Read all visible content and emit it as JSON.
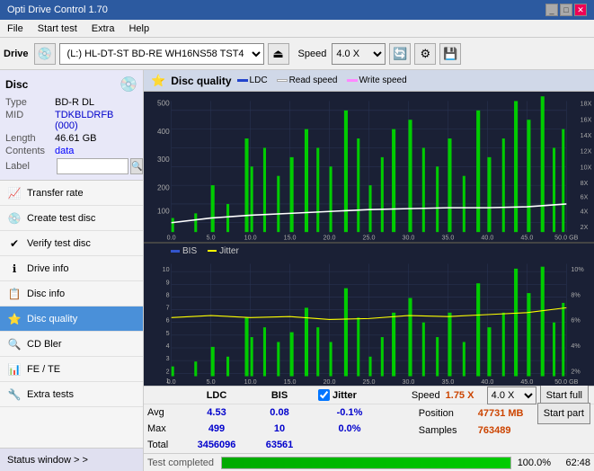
{
  "app": {
    "title": "Opti Drive Control 1.70",
    "titlebar_controls": [
      "_",
      "□",
      "✕"
    ]
  },
  "menu": {
    "items": [
      "File",
      "Start test",
      "Extra",
      "Help"
    ]
  },
  "toolbar": {
    "drive_label": "Drive",
    "drive_value": "(L:)  HL-DT-ST BD-RE  WH16NS58 TST4",
    "speed_label": "Speed",
    "speed_value": "4.0 X"
  },
  "sidebar": {
    "disc": {
      "title": "Disc",
      "type_label": "Type",
      "type_value": "BD-R DL",
      "mid_label": "MID",
      "mid_value": "TDKBLDRFB (000)",
      "length_label": "Length",
      "length_value": "46.61 GB",
      "contents_label": "Contents",
      "contents_value": "data",
      "label_label": "Label"
    },
    "nav_items": [
      {
        "id": "transfer-rate",
        "label": "Transfer rate",
        "icon": "📈"
      },
      {
        "id": "create-test-disc",
        "label": "Create test disc",
        "icon": "💿"
      },
      {
        "id": "verify-test-disc",
        "label": "Verify test disc",
        "icon": "✔"
      },
      {
        "id": "drive-info",
        "label": "Drive info",
        "icon": "ℹ"
      },
      {
        "id": "disc-info",
        "label": "Disc info",
        "icon": "📋"
      },
      {
        "id": "disc-quality",
        "label": "Disc quality",
        "icon": "⭐",
        "active": true
      },
      {
        "id": "cd-bler",
        "label": "CD Bler",
        "icon": "🔍"
      },
      {
        "id": "fe-te",
        "label": "FE / TE",
        "icon": "📊"
      },
      {
        "id": "extra-tests",
        "label": "Extra tests",
        "icon": "🔧"
      }
    ],
    "status_window": "Status window > >"
  },
  "content": {
    "title": "Disc quality",
    "legend": {
      "ldc": "LDC",
      "read_speed": "Read speed",
      "write_speed": "Write speed"
    },
    "legend2": {
      "bis": "BIS",
      "jitter": "Jitter"
    },
    "chart1": {
      "y_max": 500,
      "y_axis_right": [
        "18X",
        "16X",
        "14X",
        "12X",
        "10X",
        "8X",
        "6X",
        "4X",
        "2X"
      ],
      "x_axis": [
        "0.0",
        "5.0",
        "10.0",
        "15.0",
        "20.0",
        "25.0",
        "30.0",
        "35.0",
        "40.0",
        "45.0",
        "50.0 GB"
      ]
    },
    "chart2": {
      "y_max": 10,
      "y_axis_left": [
        "10",
        "9",
        "8",
        "7",
        "6",
        "5",
        "4",
        "3",
        "2",
        "1"
      ],
      "y_axis_right": [
        "10%",
        "8%",
        "6%",
        "4%",
        "2%"
      ],
      "x_axis": [
        "0.0",
        "5.0",
        "10.0",
        "15.0",
        "20.0",
        "25.0",
        "30.0",
        "35.0",
        "40.0",
        "45.0",
        "50.0 GB"
      ]
    }
  },
  "stats": {
    "headers": [
      "LDC",
      "BIS",
      "",
      "Jitter"
    ],
    "avg_label": "Avg",
    "avg_ldc": "4.53",
    "avg_bis": "0.08",
    "avg_jitter": "-0.1%",
    "max_label": "Max",
    "max_ldc": "499",
    "max_bis": "10",
    "max_jitter": "0.0%",
    "total_label": "Total",
    "total_ldc": "3456096",
    "total_bis": "63561",
    "speed_label": "Speed",
    "speed_val": "1.75 X",
    "speed_select": "4.0 X",
    "position_label": "Position",
    "position_val": "47731 MB",
    "samples_label": "Samples",
    "samples_val": "763489",
    "start_full": "Start full",
    "start_part": "Start part",
    "jitter_checked": true,
    "jitter_label": "Jitter"
  },
  "progressbar": {
    "status": "Test completed",
    "percent": "100.0%",
    "time": "62:48"
  },
  "colors": {
    "ldc_bar": "#00dd00",
    "read_speed": "#ffffff",
    "write_speed": "#ff88ff",
    "bis_bar": "#00dd00",
    "jitter_line": "#ffff00",
    "chart_bg": "#1a2035",
    "grid_line": "#2a3555"
  }
}
